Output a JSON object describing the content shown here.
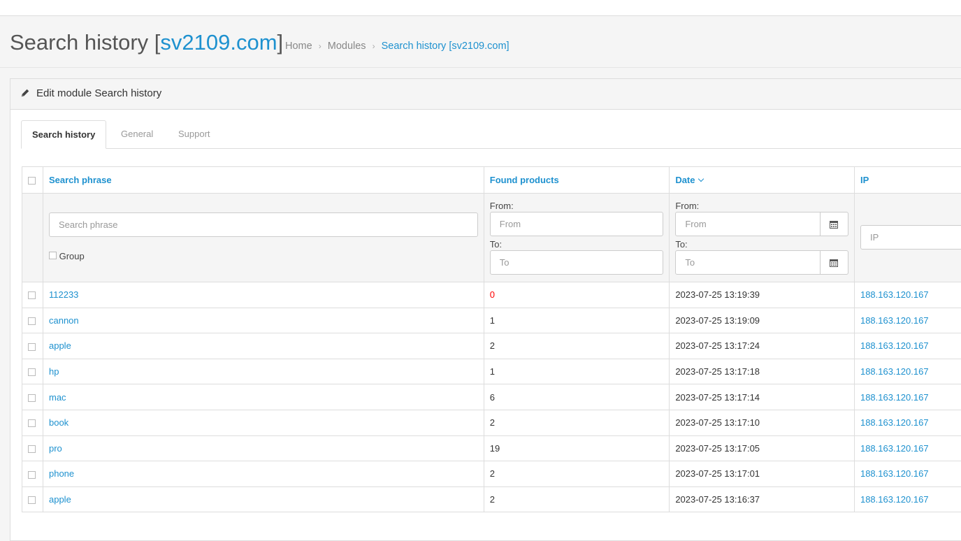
{
  "header": {
    "title_prefix": "Search history [",
    "title_domain": "sv2109.com",
    "title_suffix": "]",
    "breadcrumb": [
      {
        "label": "Home"
      },
      {
        "label": "Modules"
      },
      {
        "label": "Search history [sv2109.com]"
      }
    ],
    "breadcrumb_sep": "›"
  },
  "panel": {
    "heading": "Edit module Search history",
    "icon": "pencil-icon"
  },
  "tabs": [
    {
      "label": "Search history",
      "active": true
    },
    {
      "label": "General",
      "active": false
    },
    {
      "label": "Support",
      "active": false
    }
  ],
  "table": {
    "columns": {
      "phrase": "Search phrase",
      "found": "Found products",
      "date": "Date",
      "ip": "IP"
    },
    "sort": {
      "column": "Date",
      "direction": "desc"
    },
    "filters": {
      "phrase_placeholder": "Search phrase",
      "group_label": "Group",
      "from_label": "From:",
      "to_label": "To:",
      "from_placeholder": "From",
      "to_placeholder": "To",
      "ip_placeholder": "IP",
      "calendar_icon": "calendar-icon"
    },
    "rows": [
      {
        "phrase": "112233",
        "found": "0",
        "date": "2023-07-25 13:19:39",
        "ip": "188.163.120.167"
      },
      {
        "phrase": "cannon",
        "found": "1",
        "date": "2023-07-25 13:19:09",
        "ip": "188.163.120.167"
      },
      {
        "phrase": "apple",
        "found": "2",
        "date": "2023-07-25 13:17:24",
        "ip": "188.163.120.167"
      },
      {
        "phrase": "hp",
        "found": "1",
        "date": "2023-07-25 13:17:18",
        "ip": "188.163.120.167"
      },
      {
        "phrase": "mac",
        "found": "6",
        "date": "2023-07-25 13:17:14",
        "ip": "188.163.120.167"
      },
      {
        "phrase": "book",
        "found": "2",
        "date": "2023-07-25 13:17:10",
        "ip": "188.163.120.167"
      },
      {
        "phrase": "pro",
        "found": "19",
        "date": "2023-07-25 13:17:05",
        "ip": "188.163.120.167"
      },
      {
        "phrase": "phone",
        "found": "2",
        "date": "2023-07-25 13:17:01",
        "ip": "188.163.120.167"
      },
      {
        "phrase": "apple",
        "found": "2",
        "date": "2023-07-25 13:16:37",
        "ip": "188.163.120.167"
      }
    ]
  },
  "colors": {
    "accent": "#1e91cf",
    "zero_found": "#ff0000"
  }
}
